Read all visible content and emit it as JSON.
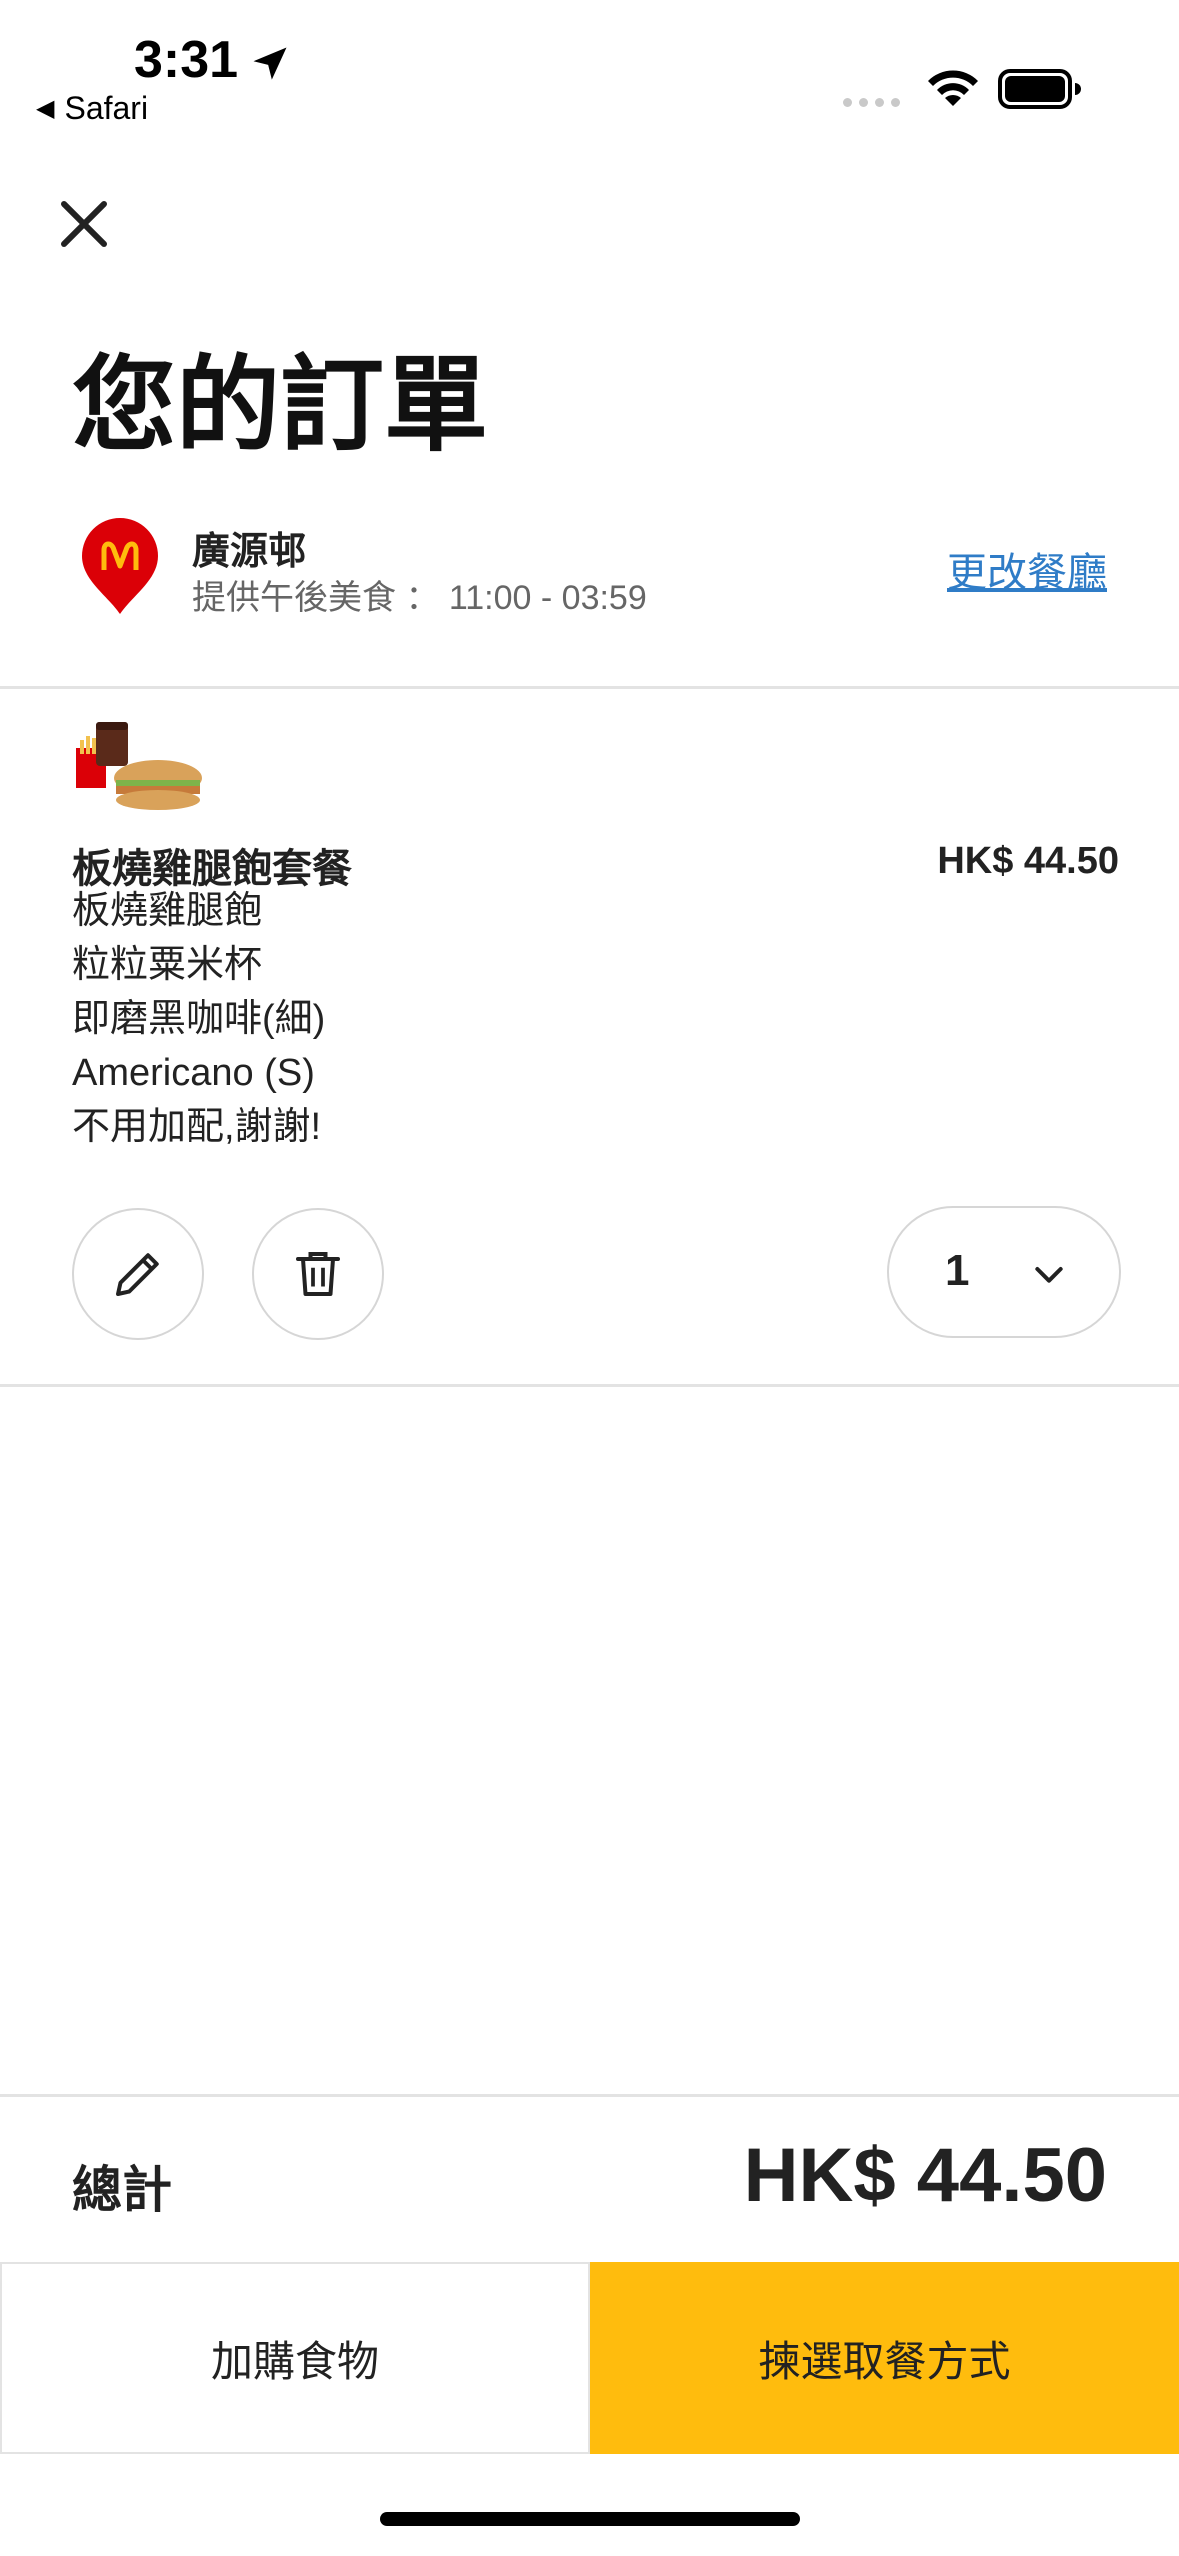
{
  "status_bar": {
    "time": "3:31",
    "back_app": "Safari"
  },
  "header": {
    "title": "您的訂單"
  },
  "store": {
    "name": "廣源邨",
    "hours": "提供午後美食 ： 11:00 - 03:59",
    "change_link": "更改餐廳"
  },
  "order": {
    "items": [
      {
        "name": "板燒雞腿飽套餐",
        "price": "HK$ 44.50",
        "details": [
          "板燒雞腿飽",
          "粒粒粟米杯",
          "即磨黑咖啡(細)",
          "Americano (S)",
          "不用加配,謝謝!"
        ],
        "quantity": "1"
      }
    ]
  },
  "footer": {
    "total_label": "總計",
    "total_value": "HK$ 44.50",
    "add_more_label": "加購食物",
    "checkout_label": "揀選取餐方式"
  },
  "colors": {
    "accent": "#ffbc0d",
    "link": "#2f7cc7",
    "brand_red": "#db0007"
  },
  "icons": [
    "location-arrow-icon",
    "wifi-icon",
    "battery-icon",
    "close-icon",
    "mcdonalds-pin-icon",
    "pencil-icon",
    "trash-icon",
    "chevron-down-icon"
  ]
}
